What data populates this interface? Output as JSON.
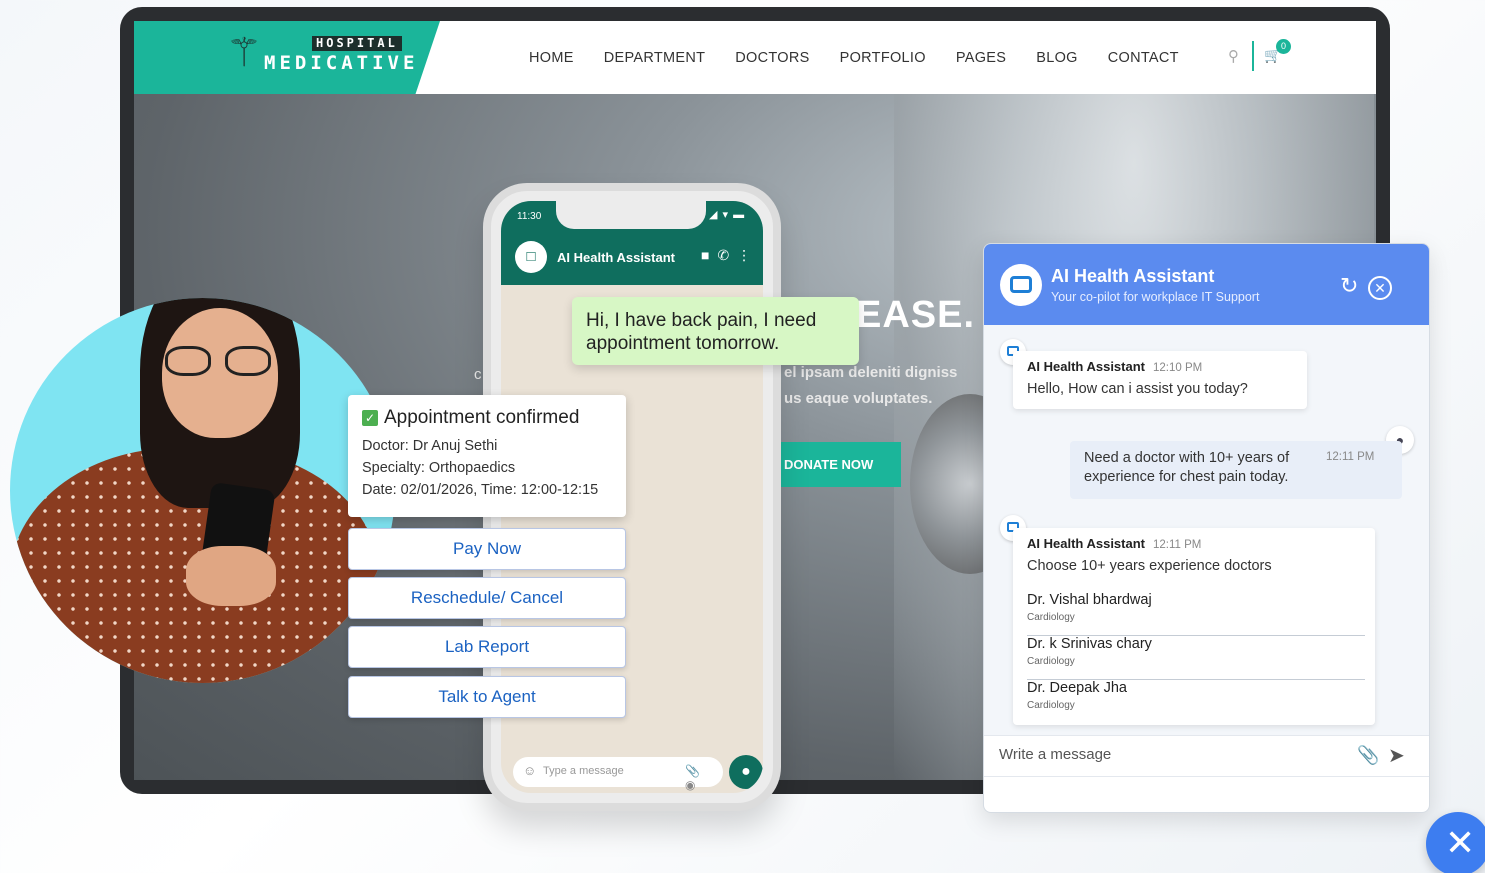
{
  "website": {
    "logo": {
      "top": "HOSPITAL",
      "bottom": "MEDICATIVE"
    },
    "nav": [
      "HOME",
      "DEPARTMENT",
      "DOCTORS",
      "PORTFOLIO",
      "PAGES",
      "BLOG",
      "CONTACT"
    ],
    "cart_count": "0",
    "hero": {
      "title_fragment": "EASE.",
      "subtitle_line1": "el ipsam deleniti digniss",
      "subtitle_line2": "us eaque voluptates.",
      "left_fragment": "c",
      "donate_label": "DONATE NOW"
    },
    "accent_color": "#1bb59a"
  },
  "phone": {
    "time": "11:30",
    "contact_name": "AI Health Assistant",
    "input_placeholder": "Type a message",
    "header_color": "#0f6e5e"
  },
  "conversation": {
    "user_message": "Hi, I have back pain, I need appointment tomorrow.",
    "appointment": {
      "title": "Appointment confirmed",
      "doctor": "Doctor: Dr Anuj Sethi",
      "specialty": "Specialty: Orthopaedics",
      "date": "Date: 02/01/2026, Time: 12:00-12:15"
    },
    "options": [
      "Pay Now",
      "Reschedule/ Cancel",
      "Lab Report",
      "Talk to Agent"
    ]
  },
  "chat_widget": {
    "title": "AI Health Assistant",
    "subtitle": "Your co-pilot for workplace IT Support",
    "header_color": "#5b8bef",
    "messages": [
      {
        "sender": "AI Health Assistant",
        "time": "12:10 PM",
        "text": "Hello, How can i assist you today?"
      },
      {
        "sender": "user",
        "time": "12:11 PM",
        "text": "Need a doctor with 10+ years of experience for chest pain today."
      },
      {
        "sender": "AI Health Assistant",
        "time": "12:11 PM",
        "text": "Choose 10+ years experience doctors"
      }
    ],
    "doctors": [
      {
        "name": "Dr. Vishal bhardwaj",
        "specialty": "Cardiology"
      },
      {
        "name": "Dr. k Srinivas chary",
        "specialty": "Cardiology"
      },
      {
        "name": "Dr. Deepak Jha",
        "specialty": "Cardiology"
      }
    ],
    "input_placeholder": "Write a message"
  }
}
